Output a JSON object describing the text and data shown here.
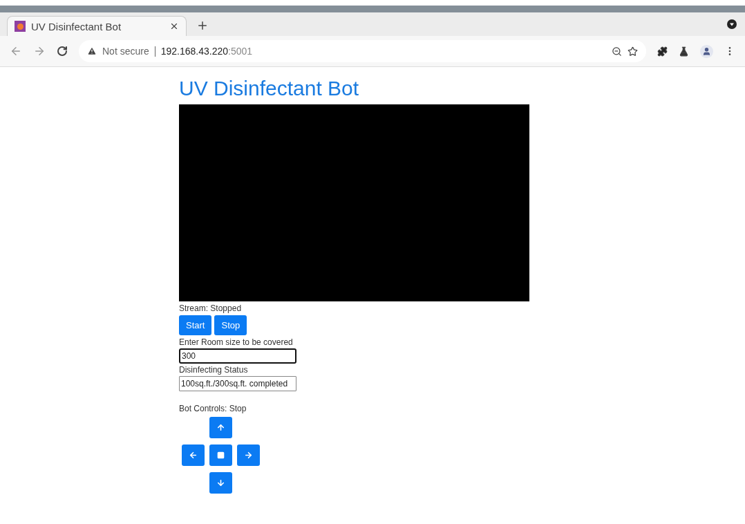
{
  "browser": {
    "tab": {
      "title": "UV Disinfectant Bot",
      "selected": true
    },
    "url": {
      "security": "Not secure",
      "host": "192.168.43.220",
      "port": ":5001"
    }
  },
  "page": {
    "heading": "UV Disinfectant Bot",
    "stream": {
      "status": "Stream: Stopped",
      "buttons": [
        "Start",
        "Stop"
      ]
    },
    "room_size": {
      "label": "Enter Room size to be covered",
      "value": "300",
      "focused": true
    },
    "disinfecting_status": {
      "label": "Disinfecting Status",
      "value": "100sq.ft./300sq.ft. completed",
      "focused": false
    },
    "bot_controls": {
      "label": "Bot Controls: Stop",
      "buttons": [
        {
          "kind": "up"
        },
        {
          "kind": "left"
        },
        {
          "kind": "stop"
        },
        {
          "kind": "right"
        },
        {
          "kind": "down"
        }
      ]
    }
  }
}
